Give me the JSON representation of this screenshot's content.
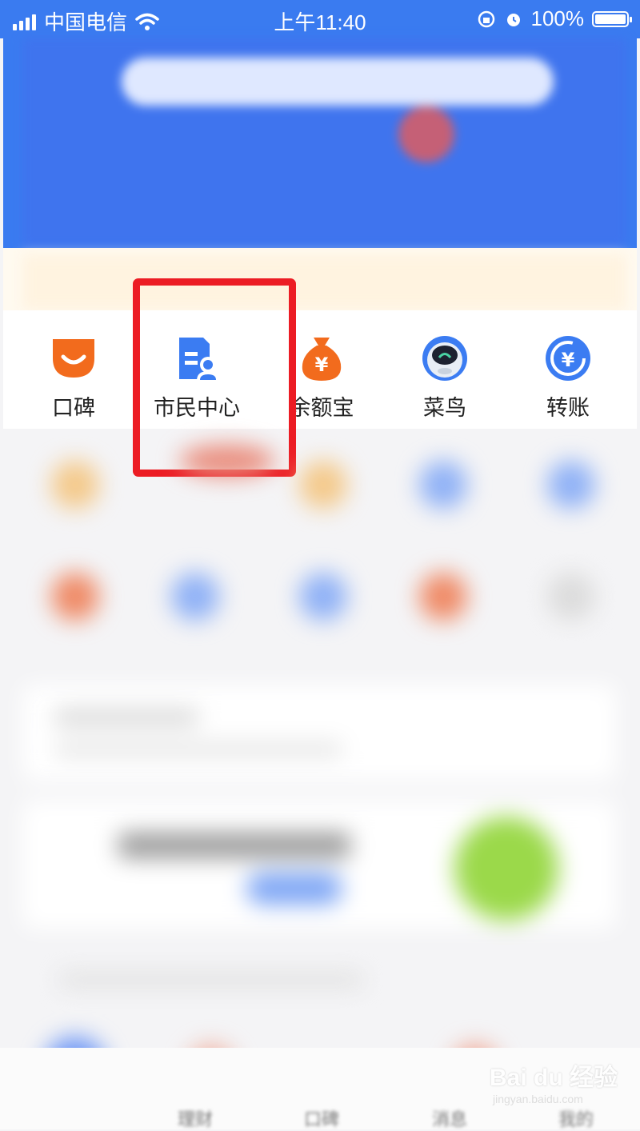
{
  "status_bar": {
    "carrier": "中国电信",
    "time": "上午11:40",
    "battery": "100%",
    "battery_level": 1.0
  },
  "app_grid": [
    {
      "label": "口碑",
      "icon": "koubei-icon",
      "color": "#f26b1d"
    },
    {
      "label": "市民中心",
      "icon": "citizen-center-icon",
      "color": "#3b7cf2"
    },
    {
      "label": "余额宝",
      "icon": "yuebao-money-bag-icon",
      "color": "#f26b1d"
    },
    {
      "label": "菜鸟",
      "icon": "cainiao-bird-icon",
      "color": "#3b7cf2"
    },
    {
      "label": "转账",
      "icon": "transfer-icon",
      "color": "#3b7cf2"
    }
  ],
  "highlight": {
    "target": "市民中心",
    "color": "#ec1c24"
  },
  "tab_bar": {
    "items": [
      "理财",
      "口碑",
      "消息",
      "我的"
    ]
  },
  "watermark": {
    "line1": "Bai du 经验",
    "line2": "jingyan.baidu.com"
  }
}
